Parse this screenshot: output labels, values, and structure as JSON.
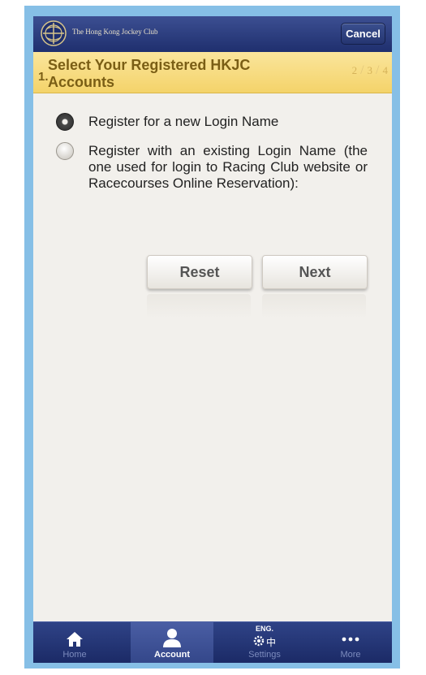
{
  "header": {
    "logo_text": "The Hong Kong Jockey Club",
    "cancel_label": "Cancel"
  },
  "step": {
    "number": "1.",
    "title": "Select Your Registered HKJC Accounts",
    "indicators": [
      "2",
      "3",
      "4"
    ]
  },
  "options": [
    {
      "label": "Register for a new Login Name",
      "selected": true
    },
    {
      "label": "Register with an existing Login Name (the one used for login to Racing Club website or Racecourses Online Reservation):",
      "selected": false
    }
  ],
  "buttons": {
    "reset_label": "Reset",
    "next_label": "Next"
  },
  "tabbar": {
    "tabs": [
      {
        "label": "Home",
        "icon": "home-icon",
        "active": false
      },
      {
        "label": "Account",
        "icon": "person-icon",
        "active": true
      },
      {
        "label": "Settings",
        "icon": "gear-icon",
        "active": false,
        "badge": "ENG.",
        "badge2": "中"
      },
      {
        "label": "More",
        "icon": "more-dots-icon",
        "active": false
      }
    ]
  }
}
